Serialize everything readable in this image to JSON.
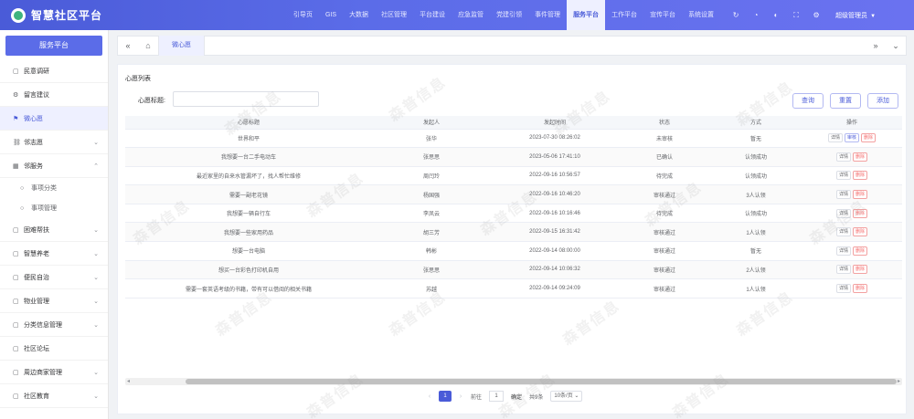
{
  "header": {
    "title": "智慧社区平台",
    "nav": [
      "引导页",
      "GIS",
      "大数据",
      "社区管理",
      "平台建设",
      "应急监管",
      "党建引领",
      "事件管理",
      "服务平台",
      "工作平台",
      "宣传平台",
      "系统设置"
    ],
    "active_nav_index": 8,
    "user": "超级管理员",
    "icons": [
      "refresh-icon",
      "bell-icon",
      "skin-icon",
      "fullscreen-icon",
      "settings-icon"
    ]
  },
  "sidebar": {
    "title": "服务平台",
    "items": [
      {
        "label": "民意调研",
        "icon": "doc-icon",
        "has_children": false
      },
      {
        "label": "留言建议",
        "icon": "gear-icon",
        "has_children": false
      },
      {
        "label": "微心愿",
        "icon": "flag-icon",
        "has_children": false,
        "active": true
      },
      {
        "label": "邻志愿",
        "icon": "link-icon",
        "has_children": true
      },
      {
        "label": "邻服务",
        "icon": "grid-icon",
        "has_children": true,
        "expanded": true,
        "children": [
          {
            "label": "事项分类"
          },
          {
            "label": "事项管理"
          }
        ]
      },
      {
        "label": "困难帮扶",
        "icon": "doc-icon",
        "has_children": true
      },
      {
        "label": "智慧养老",
        "icon": "doc-icon",
        "has_children": true
      },
      {
        "label": "便民自治",
        "icon": "doc-icon",
        "has_children": true
      },
      {
        "label": "物业管理",
        "icon": "doc-icon",
        "has_children": true
      },
      {
        "label": "分类信息管理",
        "icon": "doc-icon",
        "has_children": true
      },
      {
        "label": "社区论坛",
        "icon": "doc-icon",
        "has_children": false
      },
      {
        "label": "周边商家管理",
        "icon": "doc-icon",
        "has_children": true
      },
      {
        "label": "社区教育",
        "icon": "doc-icon",
        "has_children": true
      }
    ]
  },
  "tabs": {
    "items": [
      "微心愿"
    ]
  },
  "main": {
    "card_title": "心愿列表",
    "search_label": "心愿标题:",
    "search_value": "",
    "buttons": {
      "query": "查询",
      "reset": "重置",
      "add": "添加"
    },
    "columns": [
      "心愿标题",
      "发起人",
      "发起时间",
      "状态",
      "方式",
      "操作"
    ],
    "rows": [
      {
        "title": "世界和平",
        "author": "张华",
        "time": "2023-07-30 08:26:02",
        "status": "未审核",
        "method": "暂无",
        "ops": [
          "详情",
          "审核",
          "删除"
        ]
      },
      {
        "title": "我想要一台二手电动车",
        "author": "张思思",
        "time": "2023-05-06 17:41:10",
        "status": "已确认",
        "method": "认领成功",
        "ops": [
          "详情",
          "删除"
        ]
      },
      {
        "title": "最近家里的自来水管漏坏了，找人帮忙维修",
        "author": "周闫玲",
        "time": "2022-09-16 10:56:57",
        "status": "待完成",
        "method": "认领成功",
        "ops": [
          "详情",
          "删除"
        ]
      },
      {
        "title": "需要一副老花镜",
        "author": "杨国强",
        "time": "2022-09-16 10:46:20",
        "status": "审核通过",
        "method": "3人认领",
        "ops": [
          "详情",
          "删除"
        ]
      },
      {
        "title": "我想要一辆自行车",
        "author": "李凤云",
        "time": "2022-09-16 10:16:46",
        "status": "待完成",
        "method": "认领成功",
        "ops": [
          "详情",
          "删除"
        ]
      },
      {
        "title": "我想要一些家用药品",
        "author": "胡三芳",
        "time": "2022-09-15 16:31:42",
        "status": "审核通过",
        "method": "1人认领",
        "ops": [
          "详情",
          "删除"
        ]
      },
      {
        "title": "想要一台电脑",
        "author": "韩彬",
        "time": "2022-09-14 08:00:00",
        "status": "审核通过",
        "method": "暂无",
        "ops": [
          "详情",
          "删除"
        ]
      },
      {
        "title": "想买一台彩色打印机自用",
        "author": "张思思",
        "time": "2022-09-14 10:06:32",
        "status": "审核通过",
        "method": "2人认领",
        "ops": [
          "详情",
          "删除"
        ]
      },
      {
        "title": "需要一套英语考级的书籍，带有可以借阅的相关书籍",
        "author": "苏越",
        "time": "2022-09-14 09:24:09",
        "status": "审核通过",
        "method": "1人认领",
        "ops": [
          "详情",
          "删除"
        ]
      }
    ]
  },
  "pagination": {
    "current_page": "1",
    "goto_prefix": "前往",
    "goto_value": "1",
    "goto_suffix": "确定",
    "total": "共9条",
    "page_size": "10条/页"
  },
  "watermark": "森普信息"
}
